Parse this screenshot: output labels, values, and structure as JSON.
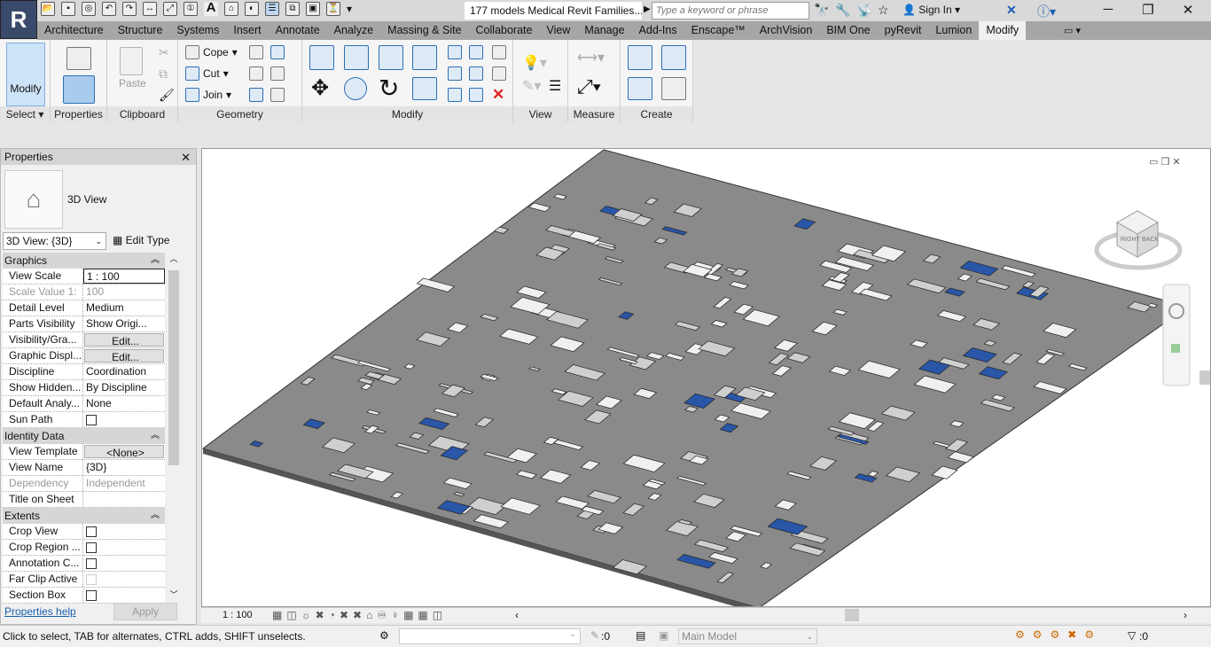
{
  "app": {
    "logo": "R",
    "title": "177 models Medical Revit Families...",
    "search_placeholder": "Type a keyword or phrase",
    "sign_in": "Sign In"
  },
  "tabs": [
    "Architecture",
    "Structure",
    "Systems",
    "Insert",
    "Annotate",
    "Analyze",
    "Massing & Site",
    "Collaborate",
    "View",
    "Manage",
    "Add-Ins",
    "Enscape™",
    "ArchVision",
    "BIM One",
    "pyRevit",
    "Lumion",
    "Modify"
  ],
  "active_tab": "Modify",
  "ribbon": {
    "modify": "Modify",
    "paste": "Paste",
    "cope": "Cope",
    "cut": "Cut",
    "join": "Join",
    "panels": {
      "select": "Select ▾",
      "properties": "Properties",
      "clipboard": "Clipboard",
      "geometry": "Geometry",
      "modify": "Modify",
      "view": "View",
      "measure": "Measure",
      "create": "Create"
    }
  },
  "properties": {
    "title": "Properties",
    "type_name": "3D View",
    "type_selector": "3D View: {3D}",
    "edit_type": "Edit Type",
    "sections": [
      {
        "name": "Graphics",
        "rows": [
          {
            "k": "View Scale",
            "v": "1 : 100",
            "kind": "input"
          },
          {
            "k": "Scale Value    1:",
            "v": "100",
            "kind": "dis"
          },
          {
            "k": "Detail Level",
            "v": "Medium"
          },
          {
            "k": "Parts Visibility",
            "v": "Show Origi..."
          },
          {
            "k": "Visibility/Gra...",
            "v": "Edit...",
            "kind": "btn"
          },
          {
            "k": "Graphic Displ...",
            "v": "Edit...",
            "kind": "btn"
          },
          {
            "k": "Discipline",
            "v": "Coordination"
          },
          {
            "k": "Show Hidden...",
            "v": "By Discipline"
          },
          {
            "k": "Default Analy...",
            "v": "None"
          },
          {
            "k": "Sun Path",
            "v": "",
            "kind": "cb"
          }
        ]
      },
      {
        "name": "Identity Data",
        "rows": [
          {
            "k": "View Template",
            "v": "<None>",
            "kind": "btn"
          },
          {
            "k": "View Name",
            "v": "{3D}"
          },
          {
            "k": "Dependency",
            "v": "Independent",
            "kind": "dis"
          },
          {
            "k": "Title on Sheet",
            "v": ""
          }
        ]
      },
      {
        "name": "Extents",
        "rows": [
          {
            "k": "Crop View",
            "v": "",
            "kind": "cb"
          },
          {
            "k": "Crop Region ...",
            "v": "",
            "kind": "cb"
          },
          {
            "k": "Annotation C...",
            "v": "",
            "kind": "cb"
          },
          {
            "k": "Far Clip Active",
            "v": "",
            "kind": "cbdis"
          },
          {
            "k": "Section Box",
            "v": "",
            "kind": "cb"
          }
        ]
      }
    ],
    "help": "Properties help",
    "apply": "Apply"
  },
  "viewcube": {
    "right": "RIGHT",
    "back": "BACK"
  },
  "viewbar": {
    "scale": "1 : 100"
  },
  "status": {
    "message": "Click to select, TAB for alternates, CTRL adds, SHIFT unselects.",
    "selection_count": ":0",
    "workset": "Main Model",
    "filter_count": ":0"
  }
}
